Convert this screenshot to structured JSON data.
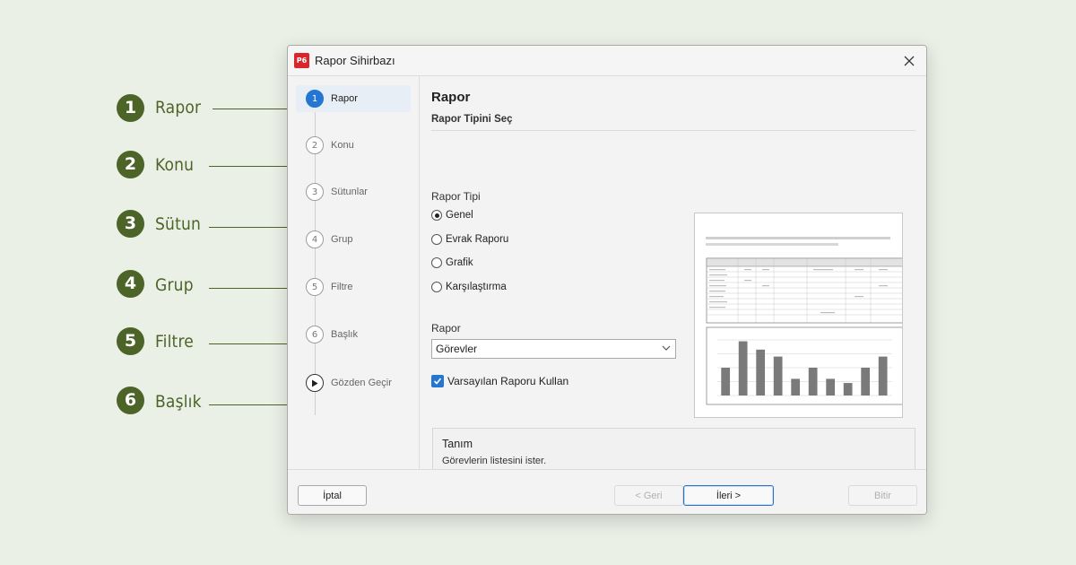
{
  "annotations": [
    {
      "num": "1",
      "label": "Rapor"
    },
    {
      "num": "2",
      "label": "Konu"
    },
    {
      "num": "3",
      "label": "Sütun"
    },
    {
      "num": "4",
      "label": "Grup"
    },
    {
      "num": "5",
      "label": "Filtre"
    },
    {
      "num": "6",
      "label": "Başlık"
    }
  ],
  "window": {
    "app_icon_text": "P6",
    "title": "Rapor Sihirbazı",
    "close_icon": "close-icon"
  },
  "sidebar": {
    "steps": [
      {
        "num": "1",
        "label": "Rapor",
        "active": true
      },
      {
        "num": "2",
        "label": "Konu"
      },
      {
        "num": "3",
        "label": "Sütunlar"
      },
      {
        "num": "4",
        "label": "Grup"
      },
      {
        "num": "5",
        "label": "Filtre"
      },
      {
        "num": "6",
        "label": "Başlık"
      },
      {
        "num": "",
        "label": "Gözden Geçir",
        "icon": "play-icon"
      }
    ]
  },
  "main": {
    "title": "Rapor",
    "subtitle": "Rapor Tipini Seç",
    "report_type_label": "Rapor Tipi",
    "report_types": [
      {
        "label": "Genel",
        "selected": true
      },
      {
        "label": "Evrak Raporu"
      },
      {
        "label": "Grafik"
      },
      {
        "label": "Karşılaştırma"
      }
    ],
    "report_label": "Rapor",
    "report_value": "Görevler",
    "use_default_label": "Varsayılan Raporu Kullan",
    "use_default_checked": true,
    "description_title": "Tanım",
    "description_text": "Görevlerin listesini ister."
  },
  "footer": {
    "cancel": "İptal",
    "back": "< Geri",
    "next": "İleri >",
    "finish": "Bitir"
  },
  "colors": {
    "annotation_green": "#4c6427",
    "accent_blue": "#2476d2",
    "background": "#ebf0e6"
  },
  "chart_data": {
    "type": "bar",
    "values": [
      200,
      390,
      330,
      280,
      120,
      200,
      120,
      90,
      200,
      280
    ],
    "ylim": [
      0,
      400
    ]
  }
}
